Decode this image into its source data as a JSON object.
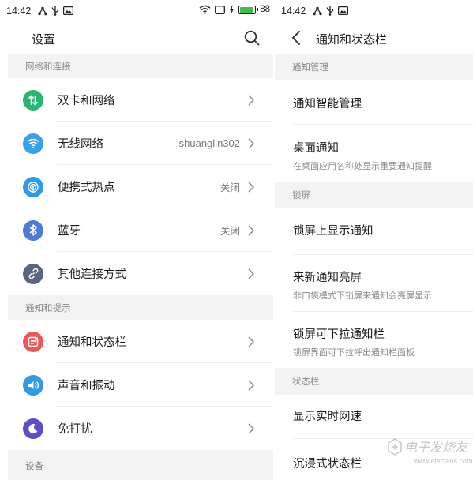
{
  "colors": {
    "dual_sim": "#2bb573",
    "wifi": "#3aa0e8",
    "hotspot": "#2f9ae6",
    "bluetooth": "#4e7bd6",
    "other_connect": "#5a6680",
    "notification": "#e85a5a",
    "sound": "#2f9ae6",
    "dnd": "#5b4fc7",
    "section_bg": "#f3f3f3",
    "battery_fill": "#3bc14a"
  },
  "left": {
    "status": {
      "time": "14:42",
      "battery": "88"
    },
    "title": "设置",
    "sections": [
      {
        "header": "网络和连接",
        "items": [
          {
            "label": "双卡和网络",
            "value": "",
            "icon": "dual-sim-icon"
          },
          {
            "label": "无线网络",
            "value": "shuanglin302",
            "icon": "wifi-icon"
          },
          {
            "label": "便携式热点",
            "value": "关闭",
            "icon": "hotspot-icon"
          },
          {
            "label": "蓝牙",
            "value": "关闭",
            "icon": "bluetooth-icon"
          },
          {
            "label": "其他连接方式",
            "value": "",
            "icon": "link-icon"
          }
        ]
      },
      {
        "header": "通知和提示",
        "items": [
          {
            "label": "通知和状态栏",
            "value": "",
            "icon": "notification-icon"
          },
          {
            "label": "声音和振动",
            "value": "",
            "icon": "sound-icon"
          },
          {
            "label": "免打扰",
            "value": "",
            "icon": "moon-icon"
          }
        ]
      },
      {
        "header": "设备"
      }
    ]
  },
  "right": {
    "status": {
      "time": "14:42"
    },
    "title": "通知和状态栏",
    "sections": [
      {
        "header": "通知管理",
        "items": [
          {
            "title": "通知智能管理",
            "subtitle": ""
          },
          {
            "title": "桌面通知",
            "subtitle": "在桌面应用名称处显示重要通知提醒"
          }
        ]
      },
      {
        "header": "锁屏",
        "items": [
          {
            "title": "锁屏上显示通知",
            "subtitle": ""
          },
          {
            "title": "来新通知亮屏",
            "subtitle": "非口袋模式下锁屏来通知会亮屏显示"
          },
          {
            "title": "锁屏可下拉通知栏",
            "subtitle": "锁屏界面可下拉呼出通知栏面板"
          }
        ]
      },
      {
        "header": "状态栏",
        "items": [
          {
            "title": "显示实时网速",
            "subtitle": ""
          },
          {
            "title": "沉浸式状态栏",
            "subtitle": ""
          }
        ]
      }
    ]
  },
  "watermark": {
    "text": "电子发烧友",
    "url": "www.elecfans.com"
  }
}
